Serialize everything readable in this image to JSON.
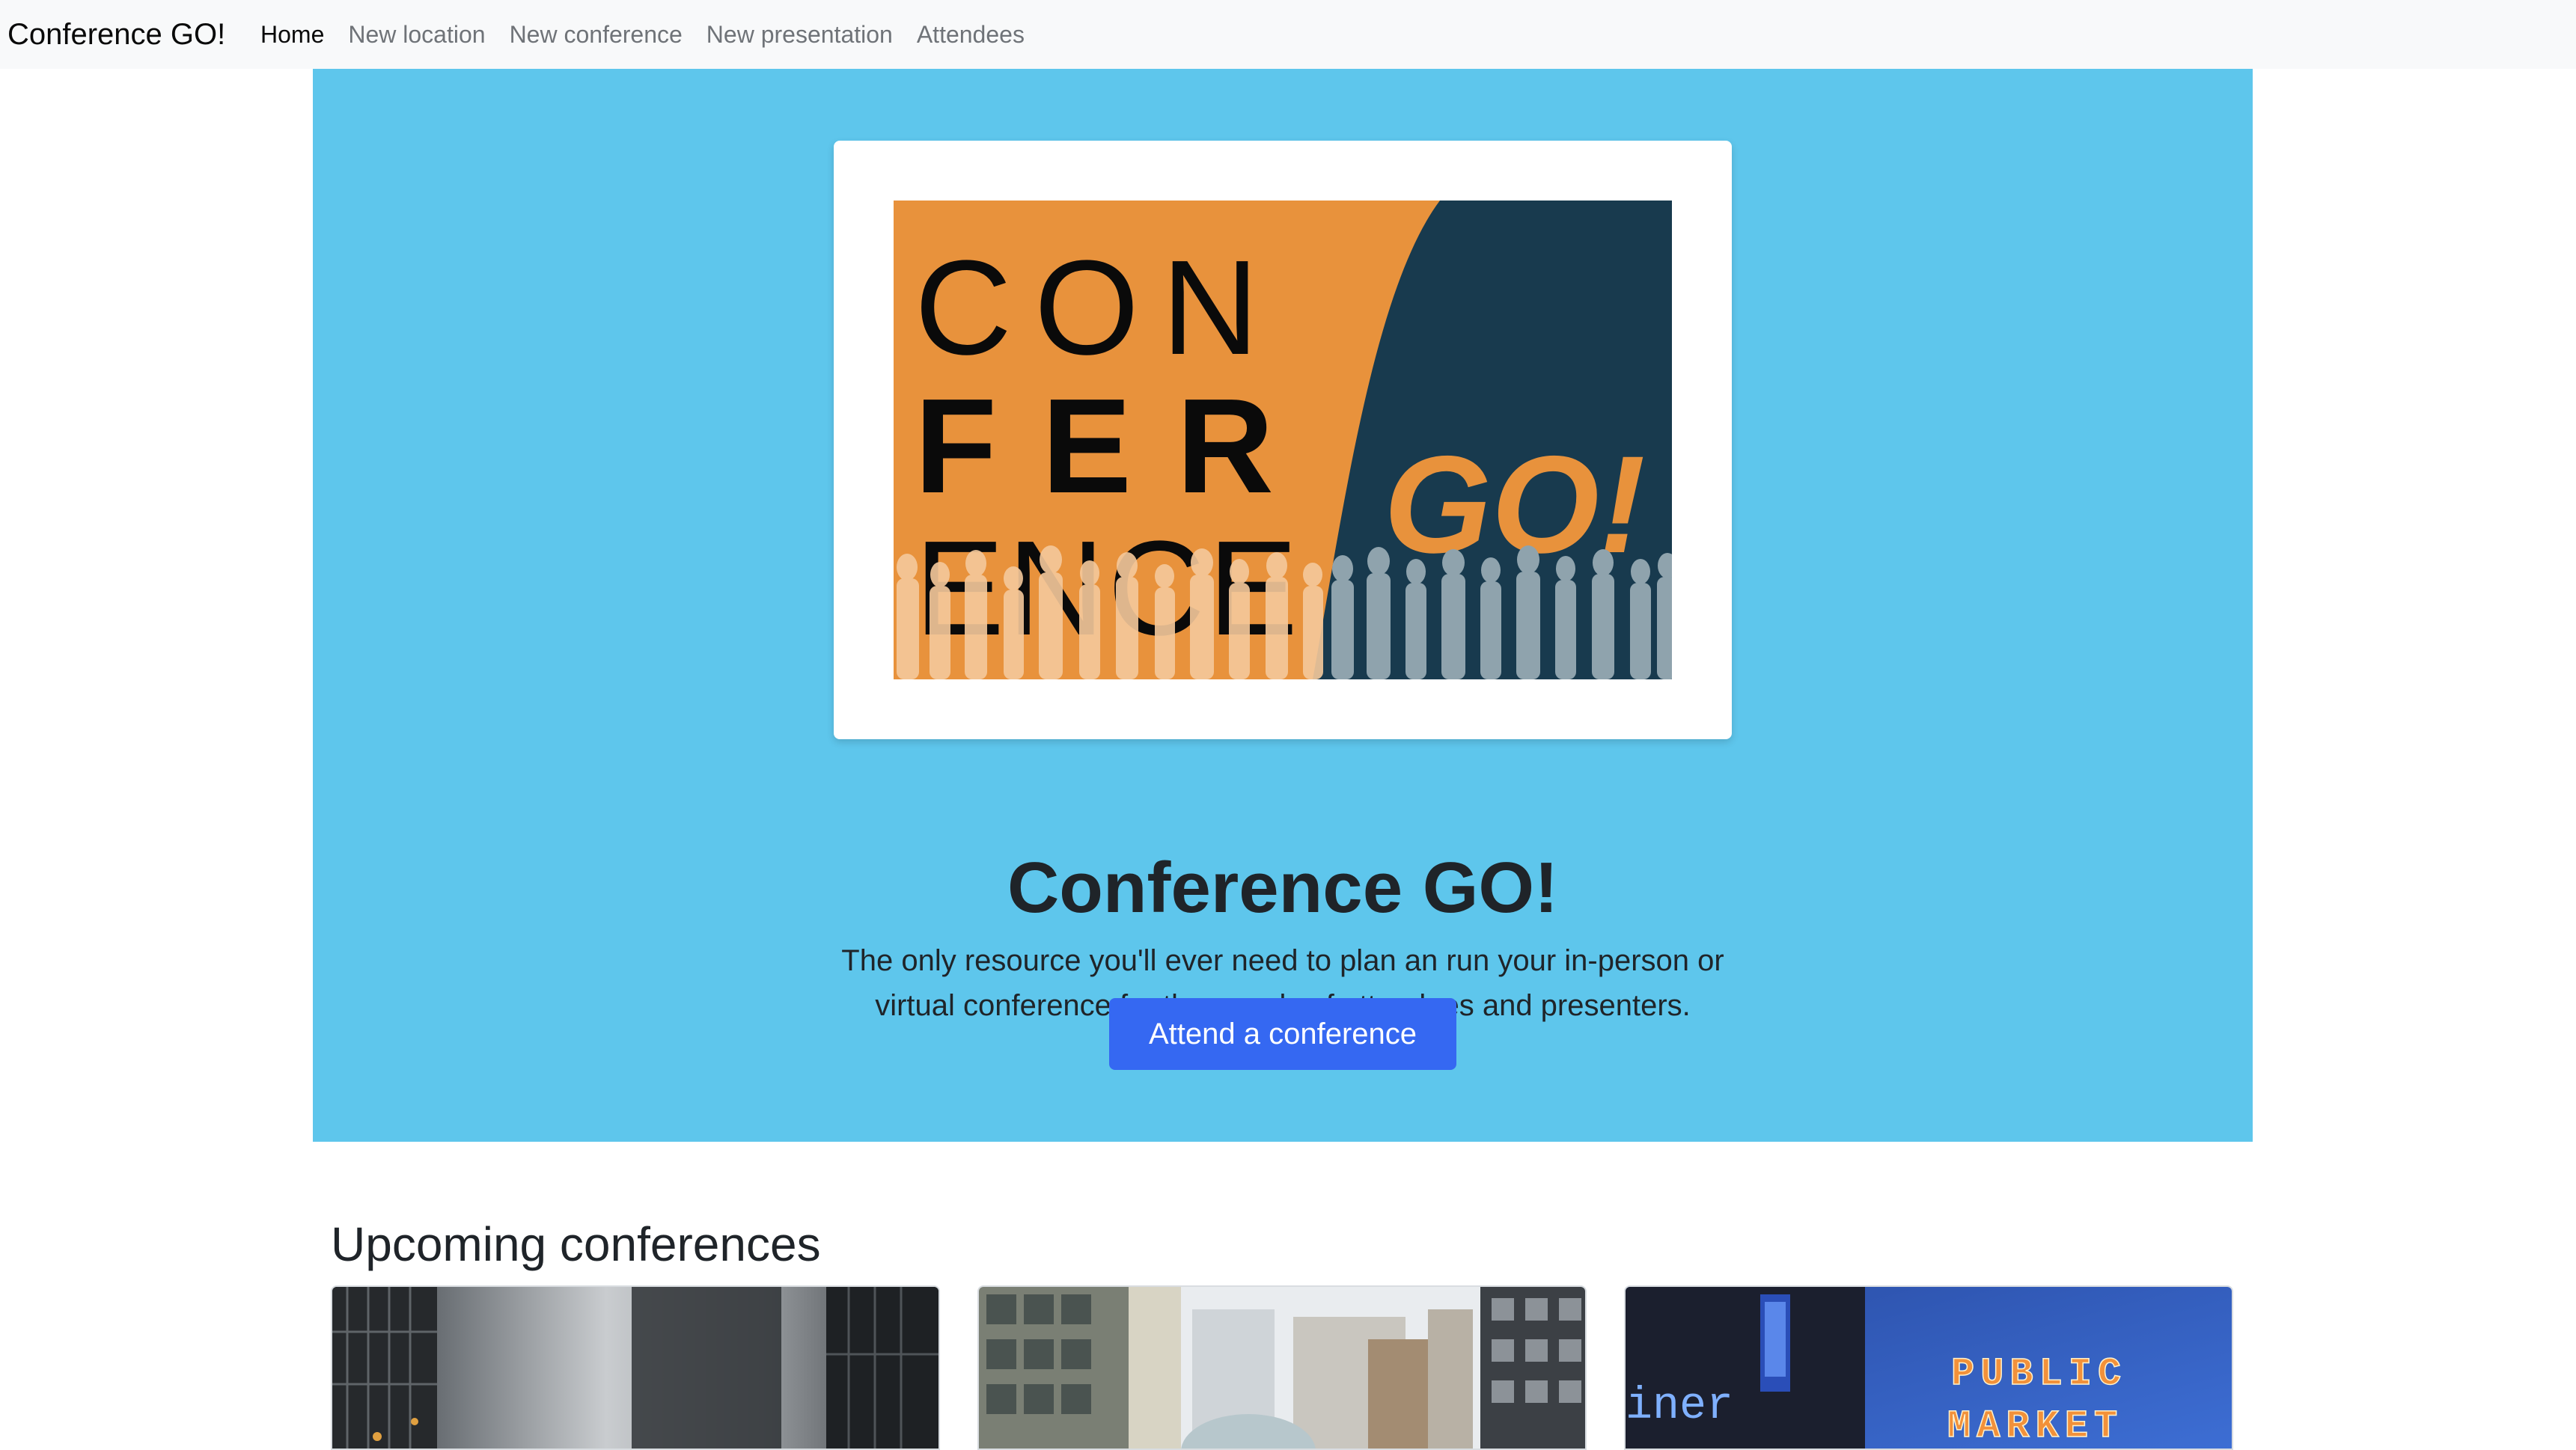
{
  "navbar": {
    "brand": "Conference GO!",
    "links": [
      {
        "label": "Home",
        "active": true
      },
      {
        "label": "New location",
        "active": false
      },
      {
        "label": "New conference",
        "active": false
      },
      {
        "label": "New presentation",
        "active": false
      },
      {
        "label": "Attendees",
        "active": false
      }
    ]
  },
  "hero": {
    "logo": {
      "line1": "CON",
      "line2": "FER",
      "line3": "ENCE",
      "tag": "GO!"
    },
    "title": "Conference GO!",
    "lead_line1": "The only resource you'll ever need to plan an run your in-person or",
    "lead_line2": "virtual conference for thousands of attendees and presenters.",
    "cta_label": "Attend a conference"
  },
  "upcoming": {
    "heading": "Upcoming conferences",
    "cards": [
      {
        "image": "city-skyscrapers-photo"
      },
      {
        "image": "downtown-buildings-photo"
      },
      {
        "image": "public-market-sign-photo",
        "sign_line1": "PUBLIC",
        "sign_line2": "MARKET",
        "neon_text": "iner"
      }
    ]
  },
  "colors": {
    "navbar_bg": "#f8f9fa",
    "hero_bg": "#5ec6ec",
    "primary_button": "#3568f2",
    "logo_orange": "#e8923c",
    "logo_navy": "#183a4e"
  }
}
